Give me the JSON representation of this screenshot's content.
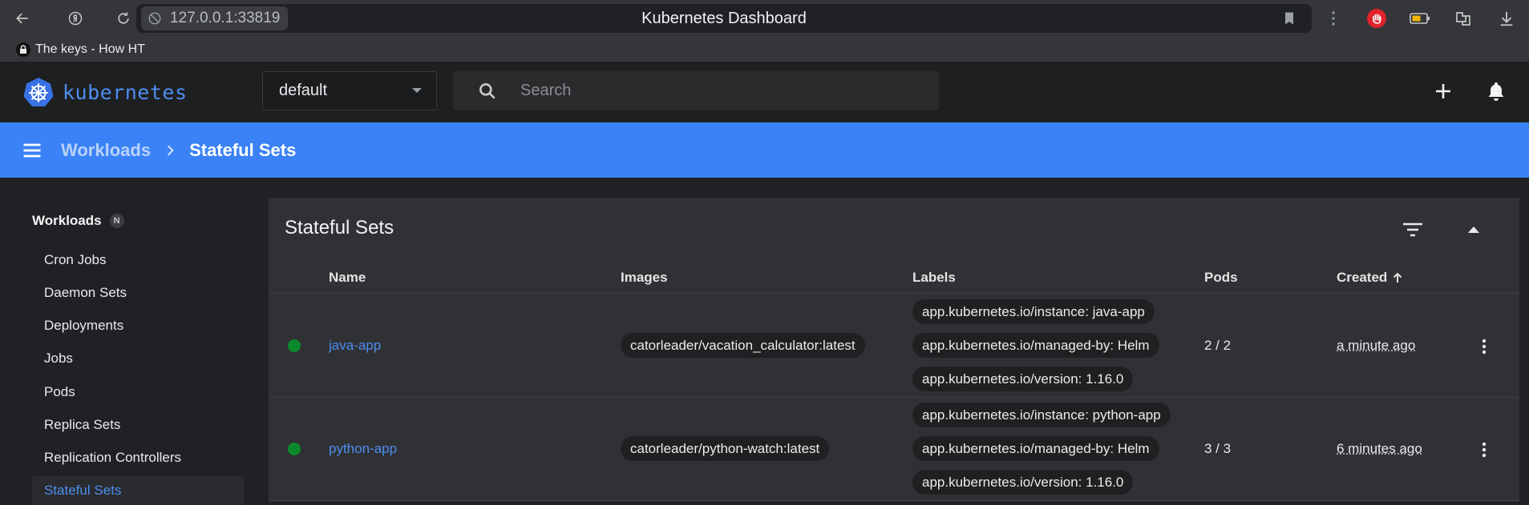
{
  "browser": {
    "url": "127.0.0.1:33819",
    "tab_title": "Kubernetes Dashboard",
    "bookmark_label": "The keys - How HT"
  },
  "toolbar": {
    "logo_text": "kubernetes",
    "namespace": "default",
    "search_placeholder": "Search"
  },
  "breadcrumb": {
    "parent": "Workloads",
    "current": "Stateful Sets"
  },
  "sidebar": {
    "section_title": "Workloads",
    "section_badge": "N",
    "items": [
      {
        "label": "Cron Jobs"
      },
      {
        "label": "Daemon Sets"
      },
      {
        "label": "Deployments"
      },
      {
        "label": "Jobs"
      },
      {
        "label": "Pods"
      },
      {
        "label": "Replica Sets"
      },
      {
        "label": "Replication Controllers"
      },
      {
        "label": "Stateful Sets",
        "active": true
      }
    ]
  },
  "card": {
    "title": "Stateful Sets",
    "columns": [
      "Name",
      "Images",
      "Labels",
      "Pods",
      "Created"
    ],
    "rows": [
      {
        "status": "running",
        "name": "java-app",
        "image": "catorleader/vacation_calculator:latest",
        "labels": [
          "app.kubernetes.io/instance: java-app",
          "app.kubernetes.io/managed-by: Helm",
          "app.kubernetes.io/version: 1.16.0"
        ],
        "pods": "2 / 2",
        "created": "a minute ago"
      },
      {
        "status": "running",
        "name": "python-app",
        "image": "catorleader/python-watch:latest",
        "labels": [
          "app.kubernetes.io/instance: python-app",
          "app.kubernetes.io/managed-by: Helm",
          "app.kubernetes.io/version: 1.16.0"
        ],
        "pods": "3 / 3",
        "created": "6 minutes ago"
      }
    ]
  },
  "colors": {
    "accent": "#3b82f6",
    "link": "#4d8ef0",
    "status_ok": "#0b8a2b",
    "toolbar_bg": "#1e1f20",
    "card_bg": "#303134"
  }
}
